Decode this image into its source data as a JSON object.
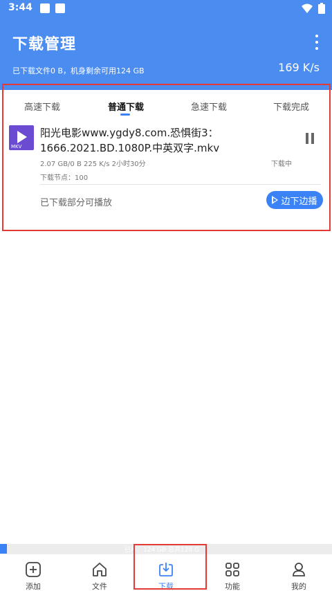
{
  "status_bar": {
    "time": "3:44"
  },
  "header": {
    "title": "下载管理",
    "storage_text": "已下载文件0 B，机身剩余可用124 GB",
    "speed": "169 K/s"
  },
  "tabs": [
    {
      "label": "高速下载"
    },
    {
      "label": "普通下载"
    },
    {
      "label": "急速下载"
    },
    {
      "label": "下载完成"
    }
  ],
  "task": {
    "icon_ext": "MKV",
    "file_name": "阳光电影www.ygdy8.com.恐惧街3：1666.2021.BD.1080P.中英双字.mkv",
    "progress_info": "2.07 GB/0 B  225 K/s  2小时30分",
    "status": "下载中",
    "nodes": "下载节点：100",
    "partial_play_label": "已下载部分可播放",
    "play_button_label": "边下边播"
  },
  "storage_bar": {
    "text": "已用：124 GB  总共128 G",
    "used_fraction": 0.02
  },
  "bottom_nav": [
    {
      "label": "添加",
      "icon": "add-icon"
    },
    {
      "label": "文件",
      "icon": "home-icon"
    },
    {
      "label": "下载",
      "icon": "download-icon",
      "active": true
    },
    {
      "label": "功能",
      "icon": "grid-icon"
    },
    {
      "label": "我的",
      "icon": "user-icon"
    }
  ],
  "colors": {
    "accent": "#3b82f6",
    "header": "#4a8cf0",
    "highlight_border": "#e53935"
  }
}
